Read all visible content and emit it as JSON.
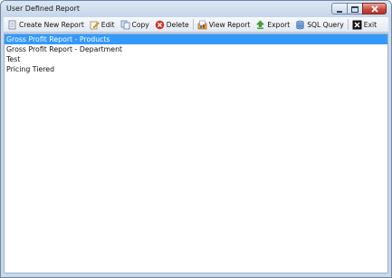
{
  "window": {
    "title": "User Defined Report"
  },
  "toolbar": {
    "create_label": "Create New Report",
    "edit_label": "Edit",
    "copy_label": "Copy",
    "delete_label": "Delete",
    "view_label": "View Report",
    "export_label": "Export",
    "sql_label": "SQL Query",
    "exit_label": "Exit"
  },
  "reports": {
    "items": [
      {
        "label": "Gross Profit Report - Products",
        "selected": true
      },
      {
        "label": "Gross Profit Report - Department",
        "selected": false
      },
      {
        "label": "Test",
        "selected": false
      },
      {
        "label": "Pricing Tiered",
        "selected": false
      }
    ]
  },
  "colors": {
    "selection": "#3399ff",
    "titlebar": "#c9d8ea",
    "close_button": "#c8453a"
  }
}
